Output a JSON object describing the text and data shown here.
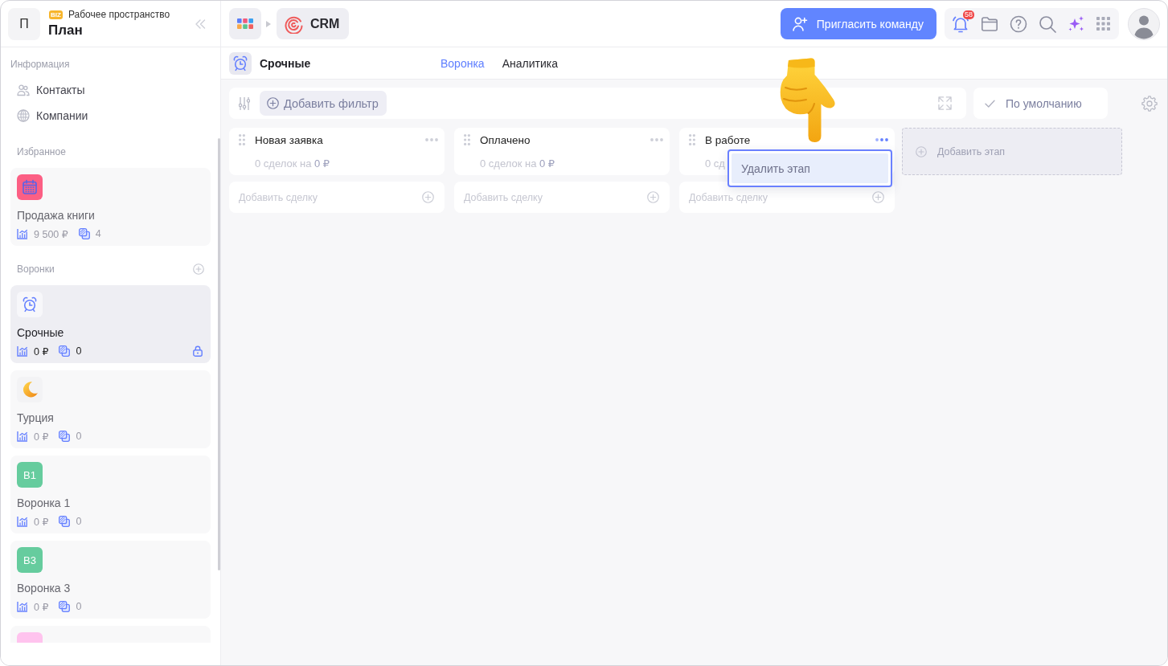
{
  "sidebar": {
    "workspace": {
      "initial": "П",
      "badge": "BIZ",
      "label": "Рабочее пространство",
      "name": "План"
    },
    "sections": [
      {
        "kind": "links",
        "title": "Информация",
        "addable": false,
        "items": [
          {
            "kind": "people",
            "label": "Контакты"
          },
          {
            "kind": "globe",
            "label": "Компании"
          }
        ]
      },
      {
        "kind": "cards",
        "title": "Избранное",
        "addable": false,
        "items": [
          {
            "tile": {
              "kind": "calendar",
              "color": "#fc5f84"
            },
            "title": "Продажа книги",
            "amount": "9 500 ₽",
            "count": "4",
            "selected": false,
            "locked": false
          }
        ]
      },
      {
        "kind": "cards",
        "title": "Воронки",
        "addable": true,
        "items": [
          {
            "tile": {
              "kind": "alarm",
              "color": "#f7f7fa"
            },
            "title": "Срочные",
            "amount": "0 ₽",
            "count": "0",
            "selected": true,
            "locked": true
          },
          {
            "tile": {
              "kind": "moon",
              "color": "#f3f3f5"
            },
            "title": "Турция",
            "amount": "0 ₽",
            "count": "0",
            "selected": false,
            "locked": false
          },
          {
            "tile": {
              "kind": "initials",
              "color": "#66cc9e",
              "text": "В1"
            },
            "title": "Воронка 1",
            "amount": "0 ₽",
            "count": "0",
            "selected": false,
            "locked": false
          },
          {
            "tile": {
              "kind": "initials",
              "color": "#66cc9e",
              "text": "В3"
            },
            "title": "Воронка 3",
            "amount": "0 ₽",
            "count": "0",
            "selected": false,
            "locked": false
          },
          {
            "tile": {
              "kind": "initials",
              "color": "#ffc3ee"
            }
          }
        ]
      }
    ]
  },
  "topbar": {
    "app": "CRM",
    "invite_button": "Пригласить команду",
    "notification_count": "58"
  },
  "funnel": {
    "title": "Срочные",
    "tabs": [
      {
        "label": "Воронка",
        "selected": true
      },
      {
        "label": "Аналитика",
        "selected": false
      }
    ]
  },
  "filters": {
    "add_filter": "Добавить фильтр",
    "view": "По умолчанию"
  },
  "board": {
    "columns": [
      {
        "title": "Новая заявка",
        "summary": "0 сделок на **0 ₽**",
        "add_deal": "Добавить сделку",
        "menu_open": false
      },
      {
        "title": "Оплачено",
        "summary": "0 сделок на **0 ₽**",
        "add_deal": "Добавить сделку",
        "menu_open": false
      },
      {
        "title": "В работе",
        "summary": "0 сд",
        "add_deal": "Добавить сделку",
        "menu_open": true,
        "menu": [
          {
            "label": "Удалить этап",
            "highlighted": true
          }
        ]
      }
    ],
    "add_stage": "Добавить этап"
  }
}
